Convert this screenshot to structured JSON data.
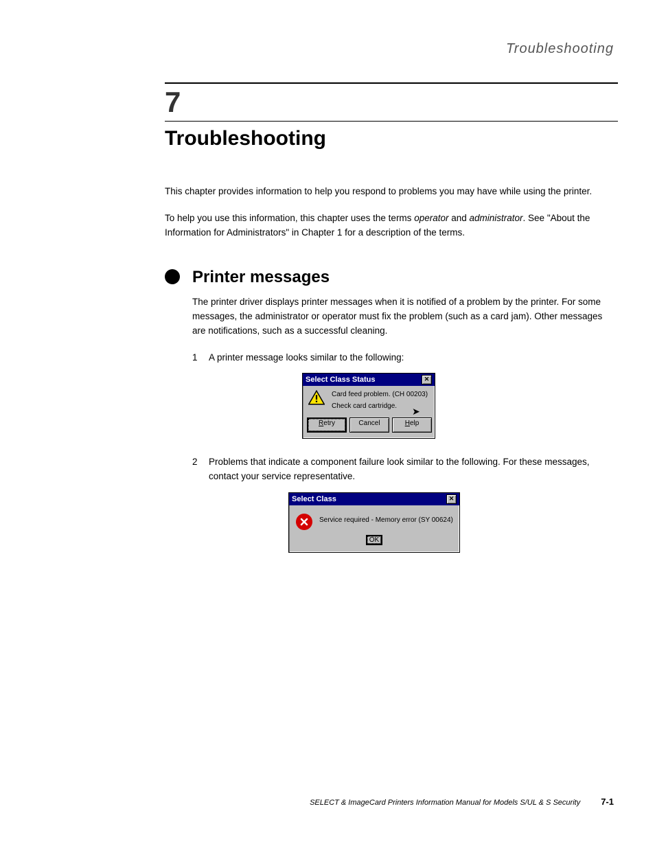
{
  "side_title": "Troubleshooting",
  "chapter_number": "7",
  "chapter_title": "Troubleshooting",
  "intro_p1": "This chapter provides information to help you respond to problems you may have while using the printer.",
  "intro_p2_prefix": "To help you use this information, this chapter uses the terms ",
  "intro_p2_em1": "operator",
  "intro_p2_mid": " and ",
  "intro_p2_em2": "administrator",
  "intro_p2_suffix": ". See \"About the Information for Administrators\" in Chapter 1 for a description of the terms.",
  "section_title": "Printer messages",
  "section_p1": "The printer driver displays printer messages when it is notified of a problem by the printer. For some messages, the administrator or operator must fix the problem (such as a card jam). Other messages are notifications, such as a successful cleaning.",
  "step1_num": "1",
  "step1_text": "A printer message looks similar to the following:",
  "dialog1": {
    "title": "Select Class Status",
    "line1": "Card feed problem.  (CH 00203)",
    "line2": "Check card cartridge.",
    "retry_mnemonic": "R",
    "retry_rest": "etry",
    "cancel": "Cancel",
    "help_mnemonic": "H",
    "help_rest": "elp"
  },
  "step2_num": "2",
  "step2_text": "Problems that indicate a component failure look similar to the following. For these messages, contact your service representative.",
  "dialog2": {
    "title": "Select Class",
    "line1": "Service required - Memory error (SY 00624)",
    "ok": "OK"
  },
  "footer_title": "SELECT & ImageCard Printers Information Manual for Models S/UL & S Security",
  "footer_page": "7-1"
}
